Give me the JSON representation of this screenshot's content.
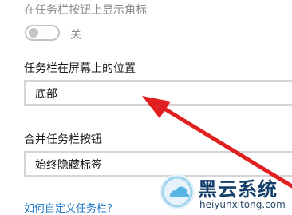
{
  "settings": {
    "badge_setting_label": "在任务栏按钮上显示角标",
    "badge_toggle_state": "关",
    "position_label": "任务栏在屏幕上的位置",
    "position_value": "底部",
    "combine_label": "合并任务栏按钮",
    "combine_value": "始终隐藏标签",
    "help_link": "如何自定义任务栏?"
  },
  "watermark": {
    "title": "黑云系统",
    "url": "heiyunxitong.com",
    "icon": "cloud-logo-icon"
  },
  "colors": {
    "link": "#1c77c8",
    "arrow": "#e02020",
    "watermark_text": "#143f6a"
  }
}
